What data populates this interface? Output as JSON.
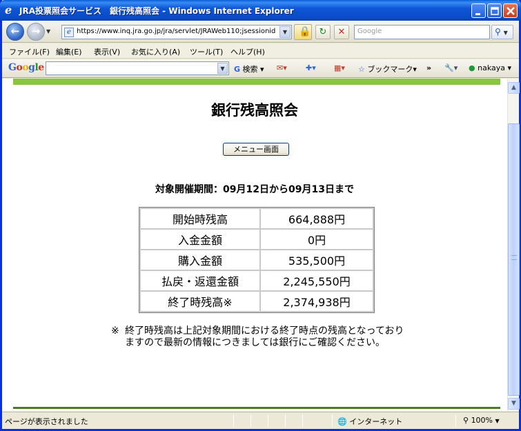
{
  "window": {
    "title": "JRA投票照会サービス　銀行残高照会 - Windows Internet Explorer"
  },
  "addressbar": {
    "url": "https://www.inq.jra.go.jp/jra/servlet/JRAWeb110;jsessionid",
    "search_placeholder": "Google"
  },
  "menubar": {
    "items": [
      "ファイル(F)",
      "編集(E)",
      "表示(V)",
      "お気に入り(A)",
      "ツール(T)",
      "ヘルプ(H)"
    ]
  },
  "googlebar": {
    "logo": "Google",
    "search_label": "検索",
    "bookmarks_label": "ブックマーク",
    "user_label": "nakaya"
  },
  "page": {
    "title": "銀行残高照会",
    "menu_button": "メニュー画面",
    "period": "対象開催期間：09月12日から09月13日まで",
    "rows": [
      {
        "label": "開始時残高",
        "value": "664,888円"
      },
      {
        "label": "入金金額",
        "value": "0円"
      },
      {
        "label": "購入金額",
        "value": "535,500円"
      },
      {
        "label": "払戻・返還金額",
        "value": "2,245,550円"
      },
      {
        "label": "終了時残高※",
        "value": "2,374,938円"
      }
    ],
    "note_mark": "※",
    "note": "終了時残高は上記対象期間における終了時点の残高となっておりますので最新の情報につきましては銀行にご確認ください。"
  },
  "statusbar": {
    "text": "ページが表示されました",
    "zone": "インターネット",
    "zoom": "100%"
  },
  "colors": {
    "title_bar": "#0d56d6",
    "page_band_top": "#8ac541",
    "page_band_bottom": "#4d7c1f"
  }
}
